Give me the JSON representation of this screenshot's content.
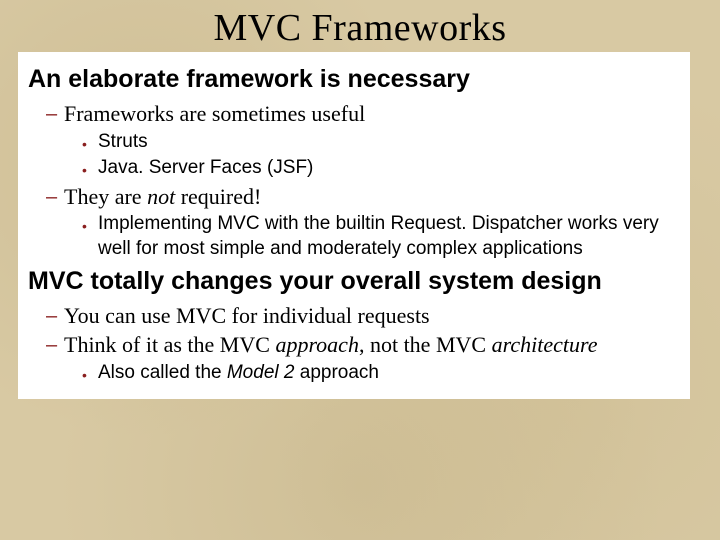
{
  "title": "MVC Frameworks",
  "sections": [
    {
      "heading": "An elaborate framework is necessary",
      "items": [
        {
          "text": "Frameworks are sometimes useful",
          "sub": [
            {
              "text": "Struts"
            },
            {
              "text": "Java. Server Faces (JSF)"
            }
          ]
        },
        {
          "pre": "They are ",
          "em": "not",
          "post": " required!",
          "sub": [
            {
              "text": "Implementing MVC with the builtin Request. Dispatcher works very well for most simple and moderately complex applications"
            }
          ]
        }
      ]
    },
    {
      "heading": "MVC totally changes your overall system design",
      "items": [
        {
          "text": "You can use MVC for individual requests"
        },
        {
          "pre": "Think of it as the MVC ",
          "em": "approach",
          "post": ", not the MVC ",
          "em2": "architecture",
          "sub": [
            {
              "pre": "Also called the ",
              "em_sans": "Model 2",
              "post": " approach"
            }
          ]
        }
      ]
    }
  ]
}
